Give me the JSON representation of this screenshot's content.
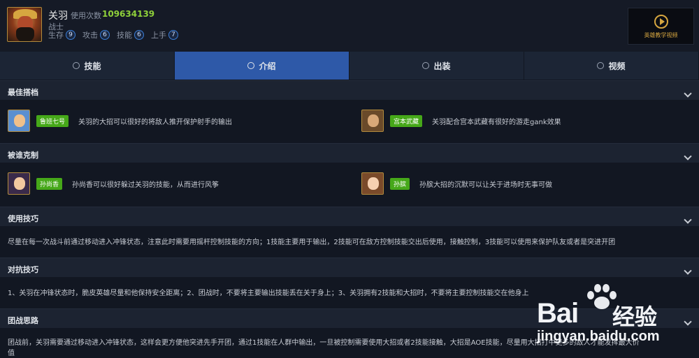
{
  "hero": {
    "name": "关羽",
    "usage_label": "使用次数",
    "usage_count": "109634139",
    "role": "战士",
    "stats": [
      {
        "label": "生存",
        "value": "9"
      },
      {
        "label": "攻击",
        "value": "6"
      },
      {
        "label": "技能",
        "value": "6"
      },
      {
        "label": "上手",
        "value": "7"
      }
    ]
  },
  "video_button": {
    "label": "英雄教学视频",
    "icon": "play-circle-icon"
  },
  "tabs": [
    {
      "label": "技能",
      "icon": "info-icon"
    },
    {
      "label": "介绍",
      "icon": "user-icon"
    },
    {
      "label": "出装",
      "icon": "equipment-icon"
    },
    {
      "label": "视频",
      "icon": "play-icon"
    }
  ],
  "sections": {
    "best_partners": {
      "title": "最佳搭档",
      "items": [
        {
          "badge": "鲁班七号",
          "text": "关羽的大招可以很好的将敌人推开保护射手的输出"
        },
        {
          "badge": "宫本武藏",
          "text": "关羽配合宫本武藏有很好的游走gank效果"
        }
      ]
    },
    "countered_by": {
      "title": "被谁克制",
      "items": [
        {
          "badge": "孙尚香",
          "text": "孙尚香可以很好躲过关羽的技能，从而进行风筝"
        },
        {
          "badge": "孙膑",
          "text": "孙膑大招的沉默可以让关于进场时无事可做"
        }
      ]
    },
    "usage_tips": {
      "title": "使用技巧",
      "text": "尽量在每一次战斗前通过移动进入冲锋状态，注意此时需要用摇杆控制技能的方向；1技能主要用于输出，2技能可在敌方控制技能交出后使用，接触控制，3技能可以使用来保护队友或者是突进开团"
    },
    "counter_tips": {
      "title": "对抗技巧",
      "text": "1、关羽在冲锋状态时，脆皮英雄尽量和他保持安全距离；2、团战时，不要将主要输出技能丢在关于身上；3、关羽拥有2技能和大招时，不要将主要控制技能交在他身上"
    },
    "teamfight": {
      "title": "团战思路",
      "line1": "团战前，关羽需要通过移动进入冲锋状态，这样会更方便他突进先手开团，通过1技能在人群中输出，一旦被控制需要使用大招或者2技能接触，大招是AOE技能，尽量用大招打中更多的敌人才能发挥最大价",
      "line2": "值"
    }
  },
  "watermark": {
    "brand": "Bai",
    "brand_suffix": "经验",
    "url": "jingyan.baidu.com"
  },
  "colors": {
    "active_tab": "#2e59a8",
    "badge": "#46a819",
    "usage_count": "#8fd13a",
    "accent_gold": "#d6a640"
  }
}
